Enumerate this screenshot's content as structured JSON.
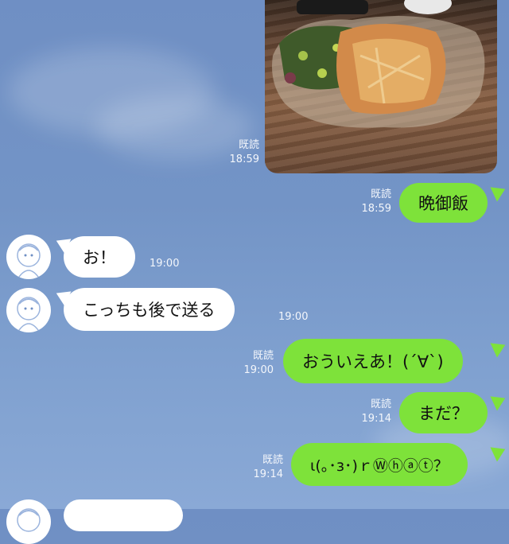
{
  "messages": [
    {
      "id": "photo",
      "type": "image",
      "read": "既読",
      "time": "18:59"
    },
    {
      "id": "m1",
      "side": "out",
      "text": "晩御飯",
      "read": "既読",
      "time": "18:59"
    },
    {
      "id": "m2",
      "side": "in",
      "text": "お！",
      "time": "19:00"
    },
    {
      "id": "m3",
      "side": "in",
      "text": "こっちも後で送る",
      "time": "19:00"
    },
    {
      "id": "m4",
      "side": "out",
      "text": "おういえあ！(´∀`)",
      "read": "既読",
      "time": "19:00"
    },
    {
      "id": "m5",
      "side": "out",
      "text": "まだ？",
      "read": "既読",
      "time": "19:14"
    },
    {
      "id": "m6",
      "side": "out",
      "text": "ι(｡･з･)ｒⓌⓗⓐⓣ？",
      "read": "既読",
      "time": "19:14"
    }
  ],
  "colors": {
    "outgoing_bubble": "#7ee23a",
    "incoming_bubble": "#ffffff",
    "background": "#7394c6"
  },
  "icons": {
    "avatar": "contact-avatar-sketch",
    "photo": "dinner-photo"
  }
}
